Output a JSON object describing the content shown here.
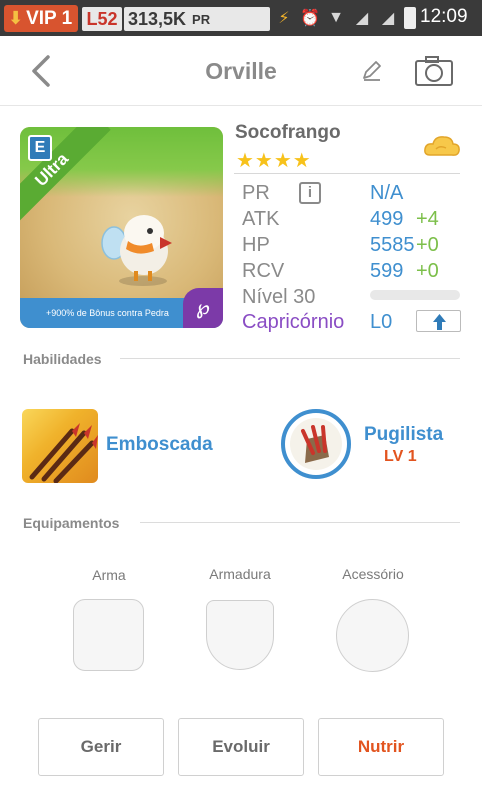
{
  "status_bar": {
    "vip_label": "VIP 1",
    "level": "L52",
    "power_value": "313,5K",
    "power_unit": "PR",
    "time": "12:09"
  },
  "header": {
    "title": "Orville",
    "icons": [
      "back-arrow-icon",
      "edit-pencil-icon",
      "camera-icon"
    ]
  },
  "monster": {
    "card_badge": "E",
    "card_ribbon": "Ultra",
    "card_bonus": "+900% de Bônus contra Pedra",
    "card_corner": "℘",
    "name": "Socofrango",
    "stars": "★★★★",
    "element_icon": "cloud-icon",
    "stats": {
      "pr_label": "PR",
      "pr_value": "N/A",
      "atk_label": "ATK",
      "atk_value": "499",
      "atk_plus": "+4",
      "hp_label": "HP",
      "hp_value": "5585",
      "hp_plus": "+0",
      "rcv_label": "RCV",
      "rcv_value": "599",
      "rcv_plus": "+0",
      "level_label": "Nível 30",
      "exp_progress": 0
    },
    "zodiac": "Capricórnio",
    "zodiac_level": "L0"
  },
  "skills": {
    "heading": "Habilidades",
    "items": [
      {
        "name": "Emboscada",
        "icon": "arrows-icon"
      },
      {
        "name": "Pugilista",
        "level": "LV 1",
        "icon": "claw-icon"
      }
    ]
  },
  "equipment": {
    "heading": "Equipamentos",
    "slots": [
      {
        "label": "Arma"
      },
      {
        "label": "Armadura"
      },
      {
        "label": "Acessório"
      }
    ]
  },
  "actions": {
    "manage": "Gerir",
    "evolve": "Evoluir",
    "feed": "Nutrir"
  },
  "colors": {
    "accent_blue": "#3f8fcf",
    "accent_orange": "#e2541f",
    "plus_green": "#7cbf4a",
    "zodiac_purple": "#8a4dc4",
    "star_yellow": "#f7c21b"
  }
}
